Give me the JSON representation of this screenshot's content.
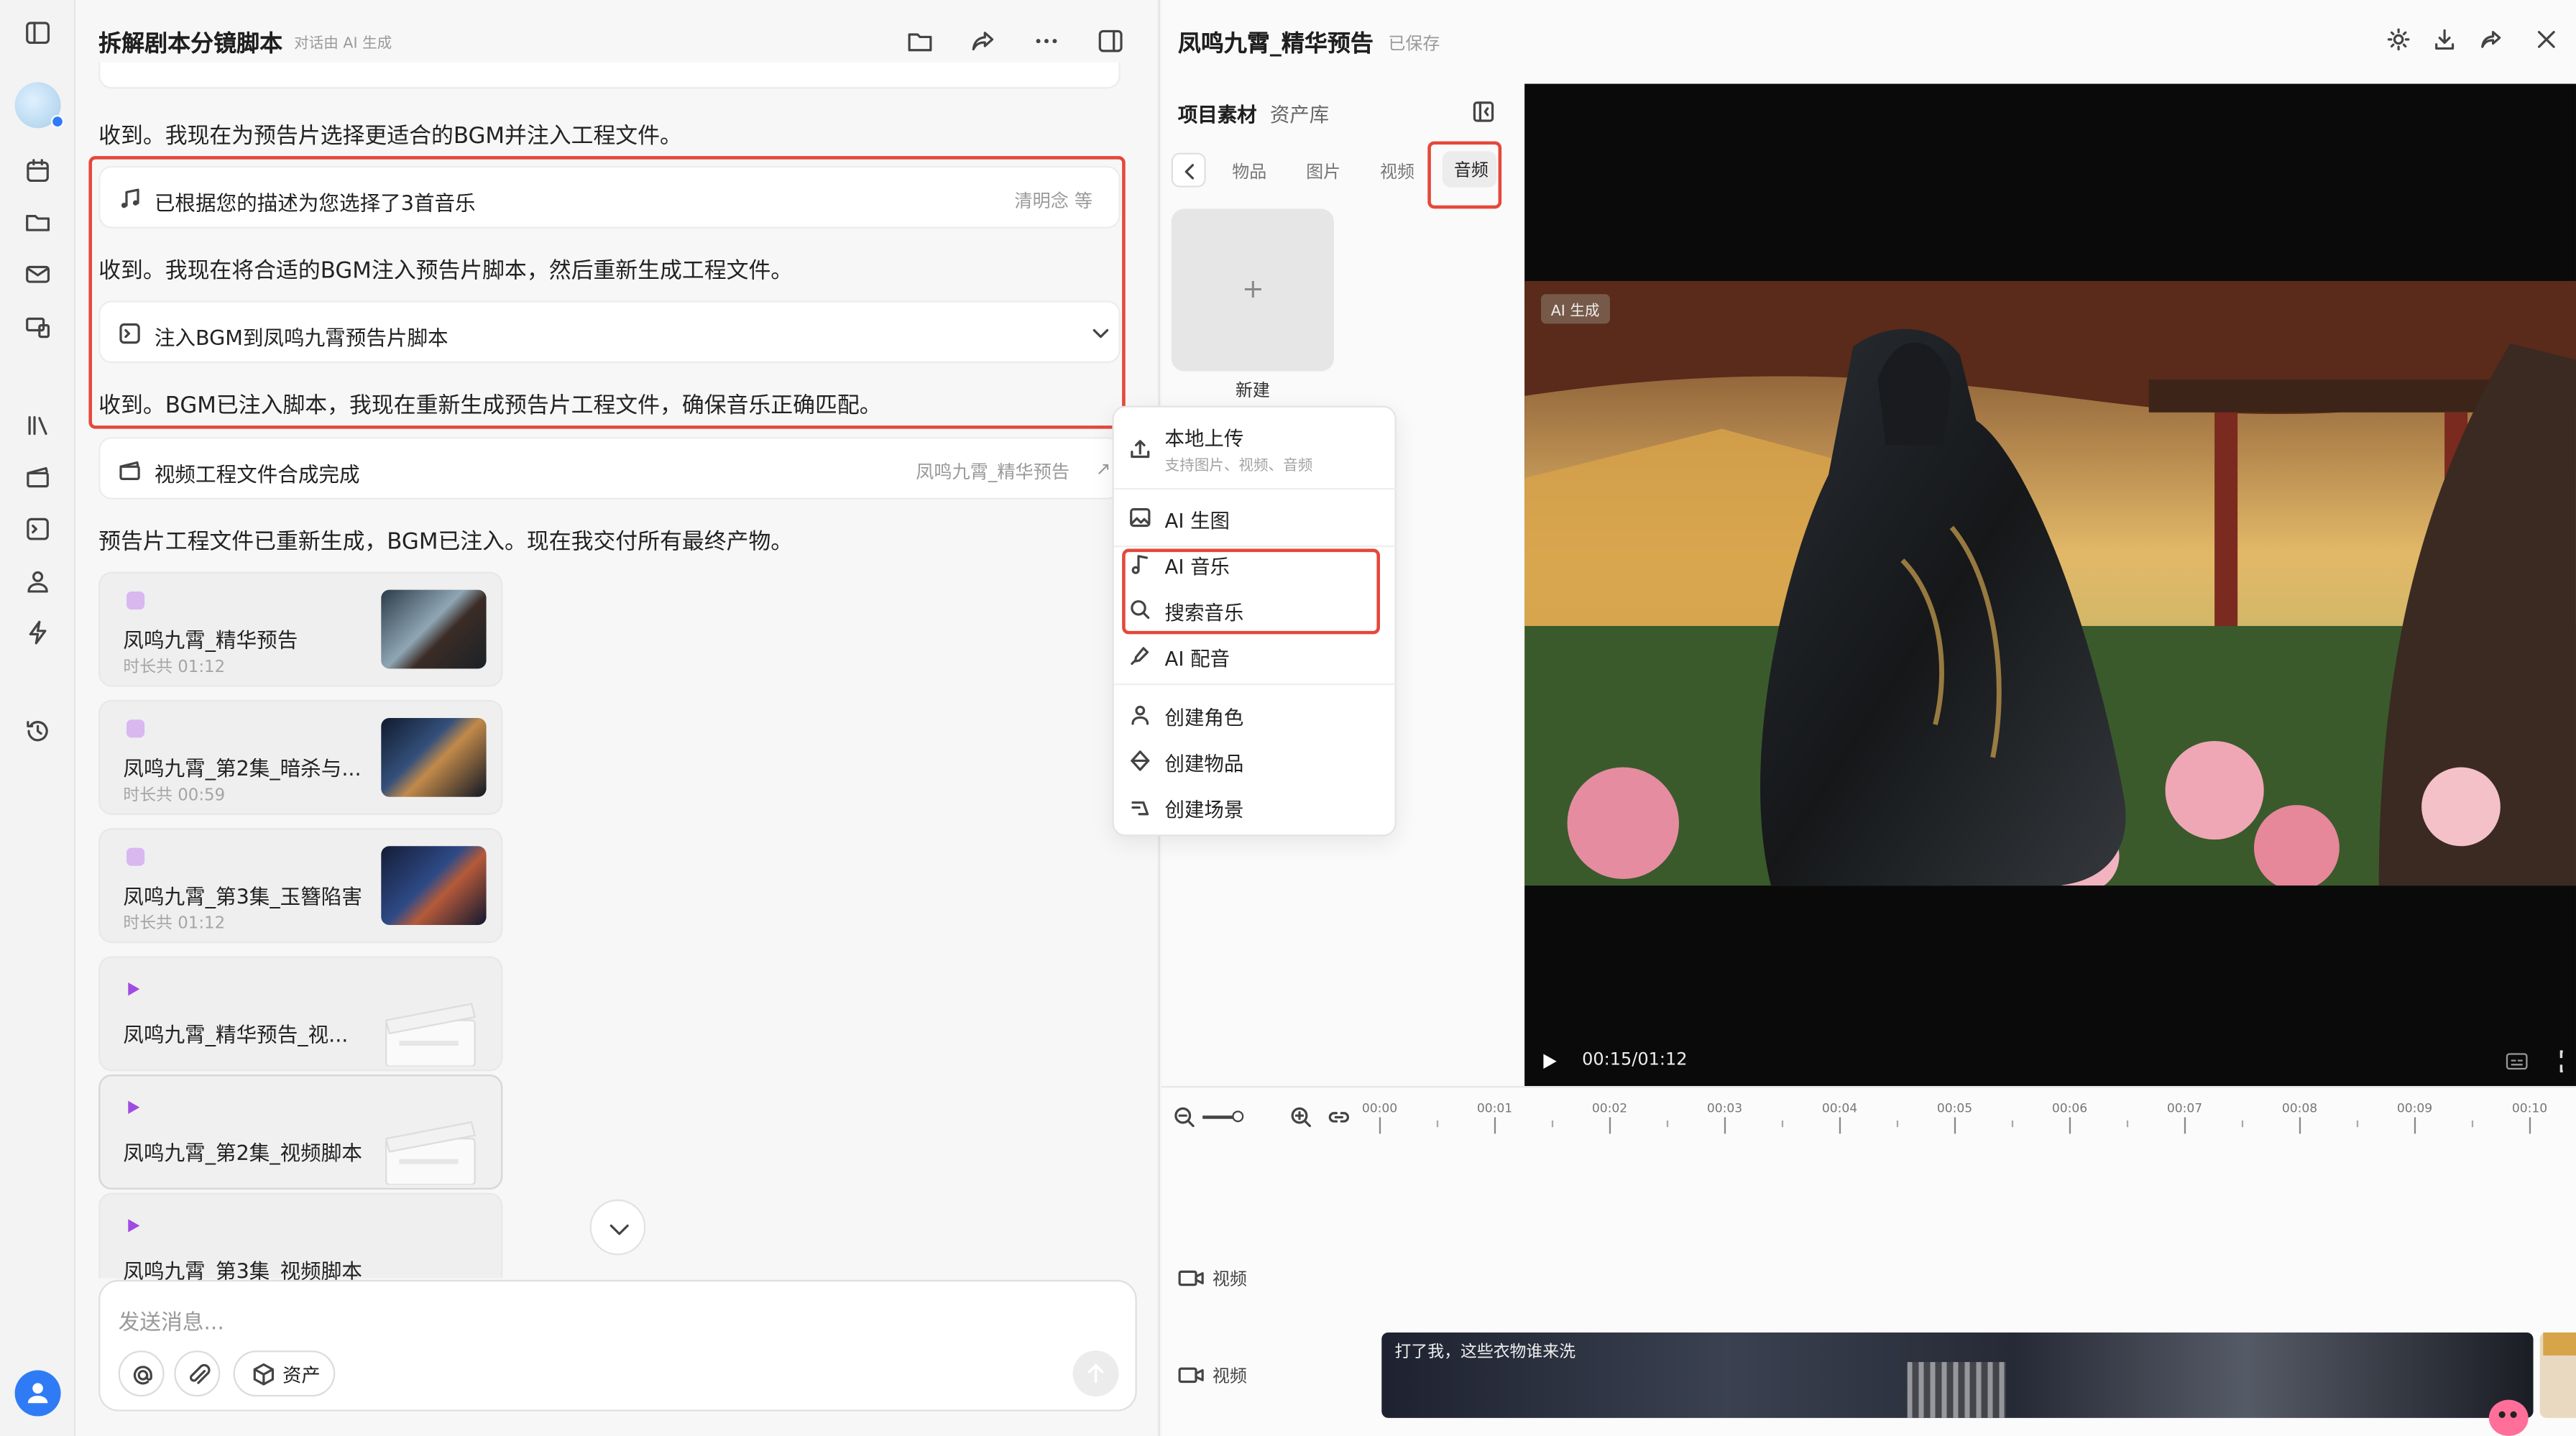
{
  "chat": {
    "title": "拆解剧本分镜脚本",
    "subtitle": "对话由 AI 生成",
    "messages": [
      "收到。我现在为预告片选择更适合的BGM并注入工程文件。",
      "收到。我现在将合适的BGM注入预告片脚本，然后重新生成工程文件。",
      "收到。BGM已注入脚本，我现在重新生成预告片工程文件，确保音乐正确匹配。",
      "预告片工程文件已重新生成，BGM已注入。现在我交付所有最终产物。"
    ],
    "cards": [
      {
        "title": "已根据您的描述为您选择了3首音乐",
        "right": "清明念 等",
        "icon": "music-note-icon"
      },
      {
        "title": "注入BGM到凤鸣九霄预告片脚本",
        "right": "",
        "icon": "script-icon"
      },
      {
        "title": "视频工程文件合成完成",
        "right": "凤鸣九霄_精华预告",
        "icon": "clapper-icon"
      }
    ],
    "files": [
      {
        "name": "凤鸣九霄_精华预告",
        "duration": "时长共 01:12",
        "kind": "video"
      },
      {
        "name": "凤鸣九霄_第2集_暗杀与...",
        "duration": "时长共 00:59",
        "kind": "video"
      },
      {
        "name": "凤鸣九霄_第3集_玉簪陷害",
        "duration": "时长共 01:12",
        "kind": "video"
      },
      {
        "name": "凤鸣九霄_精华预告_视...",
        "duration": "",
        "kind": "script"
      },
      {
        "name": "凤鸣九霄_第2集_视频脚本",
        "duration": "",
        "kind": "script"
      },
      {
        "name": "凤鸣九霄_第3集_视频脚本",
        "duration": "",
        "kind": "script"
      }
    ],
    "input_placeholder": "发送消息...",
    "assets_button": "资产"
  },
  "editor": {
    "title": "凤鸣九霄_精华预告",
    "saved": "已保存",
    "panel_tabs": [
      "项目素材",
      "资产库"
    ],
    "asset_tabs": [
      "物品",
      "图片",
      "视频",
      "音频"
    ],
    "active_asset_tab": "音频",
    "new_label": "新建",
    "menu": {
      "upload": "本地上传",
      "upload_hint": "支持图片、视频、音频",
      "items": [
        "AI 生图",
        "AI 音乐",
        "搜索音乐",
        "AI 配音",
        "创建角色",
        "创建物品",
        "创建场景"
      ]
    },
    "player": {
      "time": "00:15/01:12",
      "watermark": "AI 生成"
    },
    "timeline": {
      "ticks": [
        "00:00",
        "00:01",
        "00:02",
        "00:03",
        "00:04",
        "00:05",
        "00:06",
        "00:07",
        "00:08",
        "00:09",
        "00:10"
      ],
      "tracks": [
        "视频",
        "视频"
      ],
      "clip_caption": "打了我，这些衣物谁来洗"
    }
  },
  "colors": {
    "accent": "#2f7bf5",
    "highlight": "#e5483b"
  }
}
